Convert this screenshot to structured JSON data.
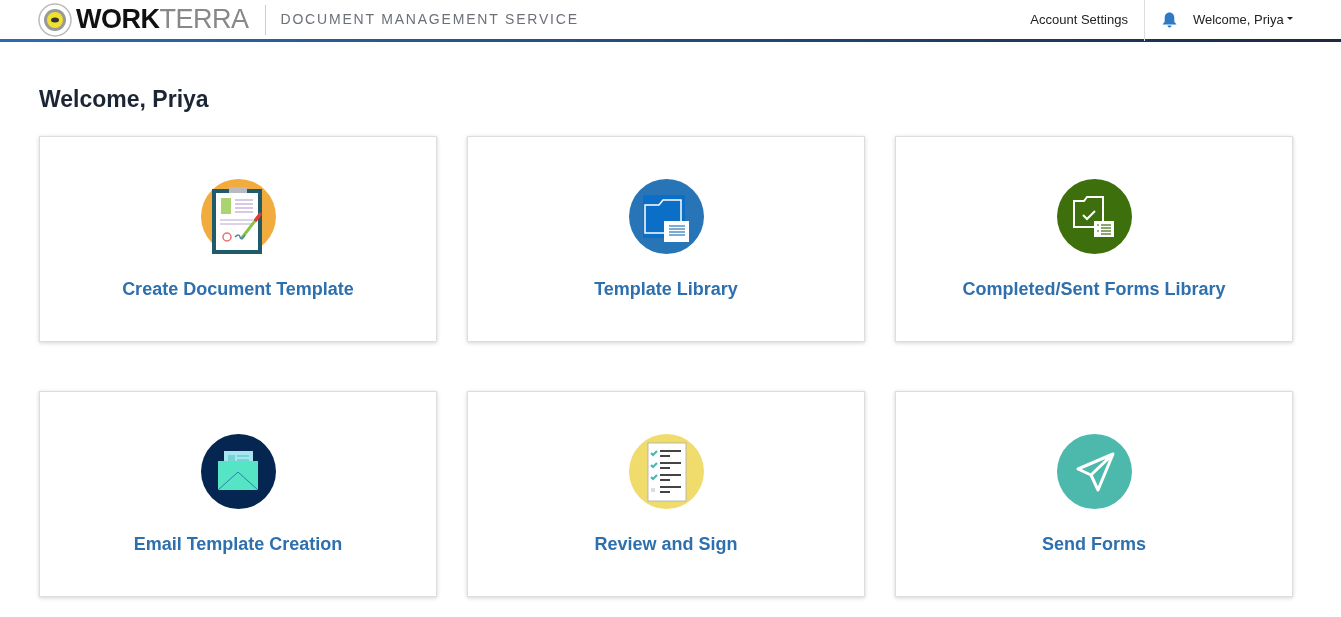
{
  "header": {
    "logo": {
      "bold": "WORK",
      "light": "TERRA"
    },
    "service_title": "DOCUMENT MANAGEMENT SERVICE",
    "account_settings": "Account Settings",
    "user_menu": "Welcome, Priya"
  },
  "heading": "Welcome, Priya",
  "tiles": [
    {
      "kind": "clipboard",
      "title": "Create Document Template"
    },
    {
      "kind": "folder",
      "title": "Template Library"
    },
    {
      "kind": "folder-check",
      "title": "Completed/Sent Forms Library"
    },
    {
      "kind": "envelope",
      "title": "Email Template Creation"
    },
    {
      "kind": "checklist",
      "title": "Review and Sign"
    },
    {
      "kind": "plane",
      "title": "Send Forms"
    }
  ]
}
